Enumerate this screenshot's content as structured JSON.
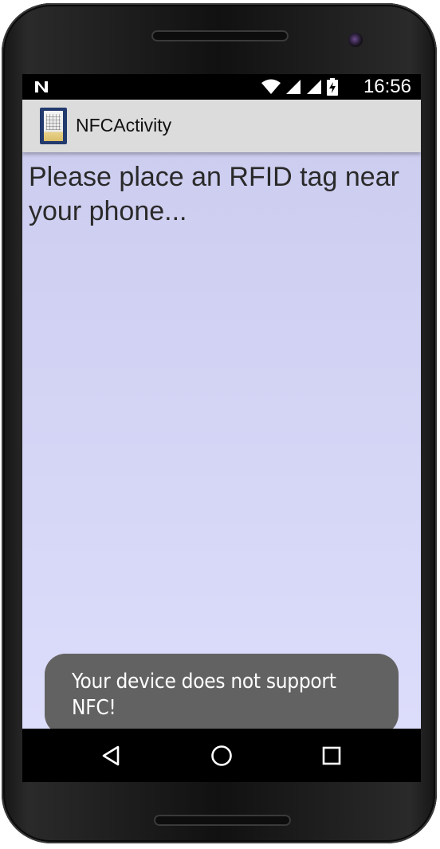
{
  "status_bar": {
    "time": "16:56",
    "icons": [
      "nfc-n-icon",
      "wifi-icon",
      "signal-icon",
      "signal-icon",
      "battery-charging-icon"
    ]
  },
  "action_bar": {
    "title": "NFCActivity",
    "icon": "app-icon"
  },
  "main": {
    "message": "Please place an RFID tag near your phone..."
  },
  "toast": {
    "text": "Your device does not support NFC!"
  },
  "nav_bar": {
    "buttons": [
      "back-icon",
      "home-icon",
      "recents-icon"
    ]
  },
  "colors": {
    "action_bar_bg": "#dcdcdc",
    "content_bg_top": "#cdcdf0",
    "content_bg_bottom": "#dcdcfb",
    "toast_bg": "#626262",
    "app_icon_frame": "#223a6e"
  }
}
